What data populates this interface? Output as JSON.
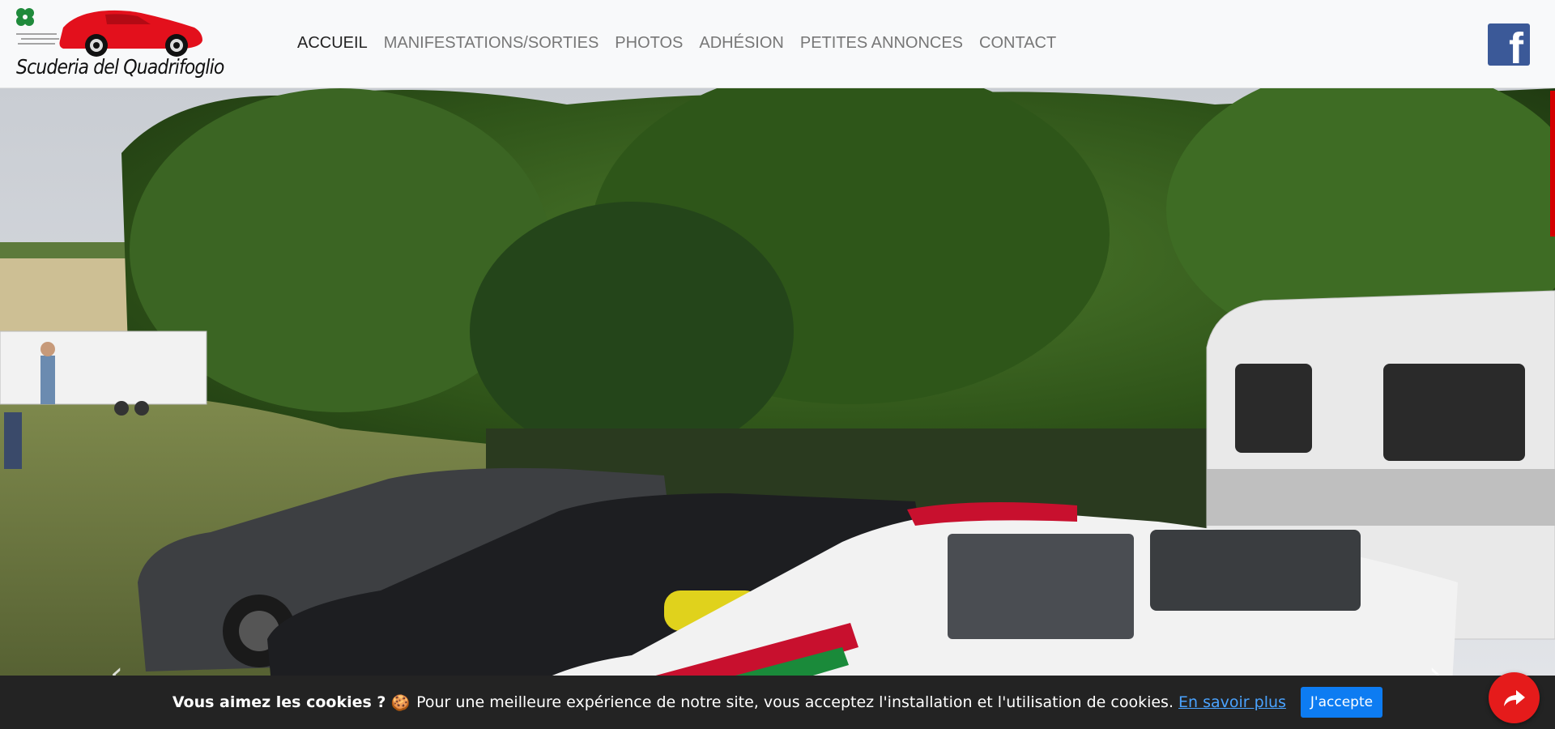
{
  "brand": {
    "name": "Scuderia del Quadrifoglio",
    "logo_icon": "red-sports-car-logo",
    "clover_icon": "four-leaf-clover-icon"
  },
  "nav": {
    "items": [
      {
        "label": "ACCUEIL",
        "active": true
      },
      {
        "label": "MANIFESTATIONS/SORTIES",
        "active": false
      },
      {
        "label": "PHOTOS",
        "active": false
      },
      {
        "label": "ADHÉSION",
        "active": false
      },
      {
        "label": "PETITES ANNONCES",
        "active": false
      },
      {
        "label": "CONTACT",
        "active": false
      }
    ]
  },
  "social": {
    "facebook_label": "f",
    "icon": "facebook-icon"
  },
  "hero": {
    "image": "alfa-romeo-race-cars-parked-near-trees-and-caravan",
    "prev_label": "‹",
    "next_label": "›"
  },
  "cookie": {
    "heading": "Vous aimez les cookies ?",
    "emoji": "🍪",
    "message": "Pour une meilleure expérience de notre site, vous acceptez l'installation et l'utilisation de cookies.",
    "link_label": "En savoir plus",
    "accept_label": "J'accepte"
  },
  "share": {
    "icon": "share-arrow-icon"
  },
  "colors": {
    "brand_red": "#e51b1b",
    "facebook_blue": "#3b5998",
    "accept_blue": "#0d7cf2",
    "nav_active": "#222222",
    "nav_inactive": "#777777"
  }
}
